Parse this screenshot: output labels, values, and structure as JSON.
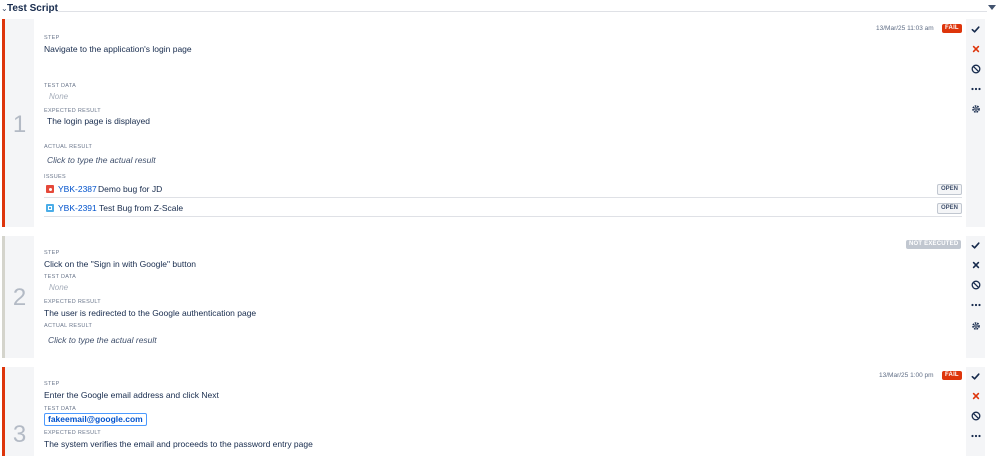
{
  "section": {
    "title": "Test Script"
  },
  "labels": {
    "step": "STEP",
    "test_data": "TEST DATA",
    "expected_result": "EXPECTED RESULT",
    "actual_result": "ACTUAL RESULT",
    "issues": "ISSUES"
  },
  "steps": [
    {
      "number": "1",
      "step": "Navigate to the application's login page",
      "test_data": "None",
      "expected_result": "The login page is displayed",
      "actual_result_placeholder": "Click to type the actual result",
      "timestamp": "13/Mar/25 11:03 am",
      "status": "FAIL",
      "issues": [
        {
          "key": "YBK-2387",
          "summary": "Demo bug for JD",
          "status": "OPEN",
          "type": "bug-icon"
        },
        {
          "key": "YBK-2391",
          "summary": "Test Bug from Z-Scale",
          "status": "OPEN",
          "type": "task-icon"
        }
      ]
    },
    {
      "number": "2",
      "step": "Click on the \"Sign in with Google\" button",
      "test_data": "None",
      "expected_result": "The user is redirected to the Google authentication page",
      "actual_result_placeholder": "Click to type the actual result",
      "status": "NOT EXECUTED"
    },
    {
      "number": "3",
      "step": "Enter the Google email address and click Next",
      "test_data": "fakeemail@google.com",
      "expected_result": "The system verifies the email and proceeds to the password entry page",
      "timestamp": "13/Mar/25 1:00 pm",
      "status": "FAIL"
    }
  ],
  "colors": {
    "fail": "#de350b",
    "not_executed": "#c1c7d0",
    "link": "#0052cc",
    "pass_icon": "#172b4d",
    "fail_icon_active": "#de350b"
  },
  "icons": {
    "actions": [
      "check-icon",
      "cross-icon",
      "blocked-icon",
      "more-icon",
      "gear-icon"
    ]
  }
}
